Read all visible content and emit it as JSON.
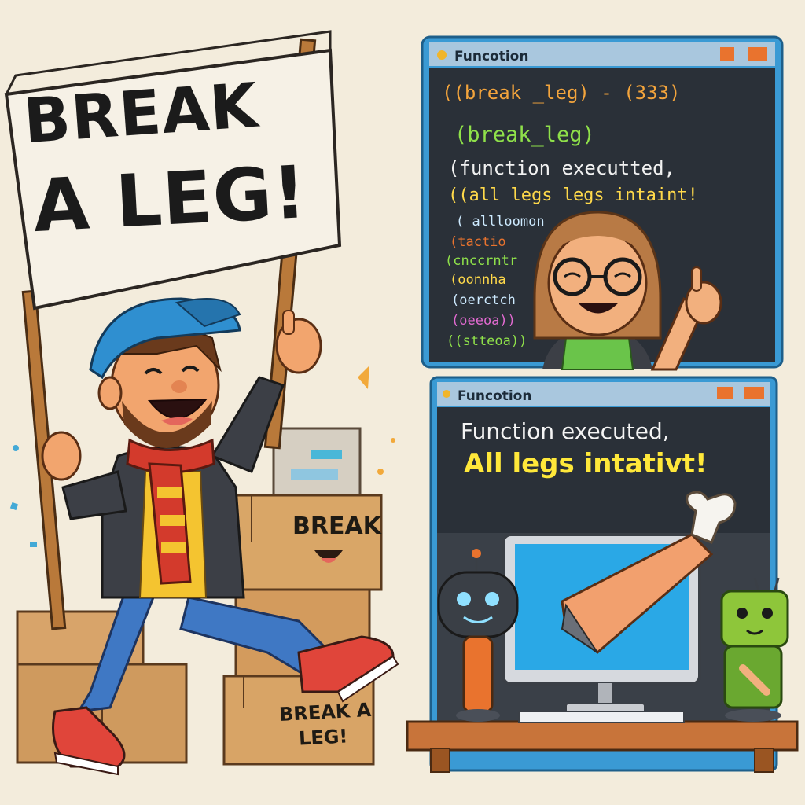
{
  "sign": {
    "line1": "BREAK",
    "line2": "A LEG!"
  },
  "boxes": {
    "box1_label": "BREAK",
    "box2_line1": "BREAK A",
    "box2_line2": "LEG!"
  },
  "top_window": {
    "title": "Funcotion",
    "code_lines": [
      "((break _leg) - (333)",
      "(break_leg)",
      "(function executted,",
      "((all legs legs intaint!",
      "( allloomon",
      "(tactio",
      "(cnccrntr",
      "(oonnha",
      "(oerctch",
      "(oeeoa))",
      "((stteoa))"
    ]
  },
  "bottom_window": {
    "title": "Funcotion",
    "message_line1": "Function executed,",
    "message_line2": "All legs intativt!"
  },
  "colors": {
    "window_frame": "#3a9ad4",
    "window_bg": "#2a3038",
    "title_bar": "#a9c7de",
    "accent_orange": "#e9732e",
    "message_yellow": "#ffe83a",
    "code_orange": "#f3a43c",
    "code_green": "#8fe14a",
    "cap_blue": "#2f8fd0",
    "desk_brown": "#c8743a"
  }
}
